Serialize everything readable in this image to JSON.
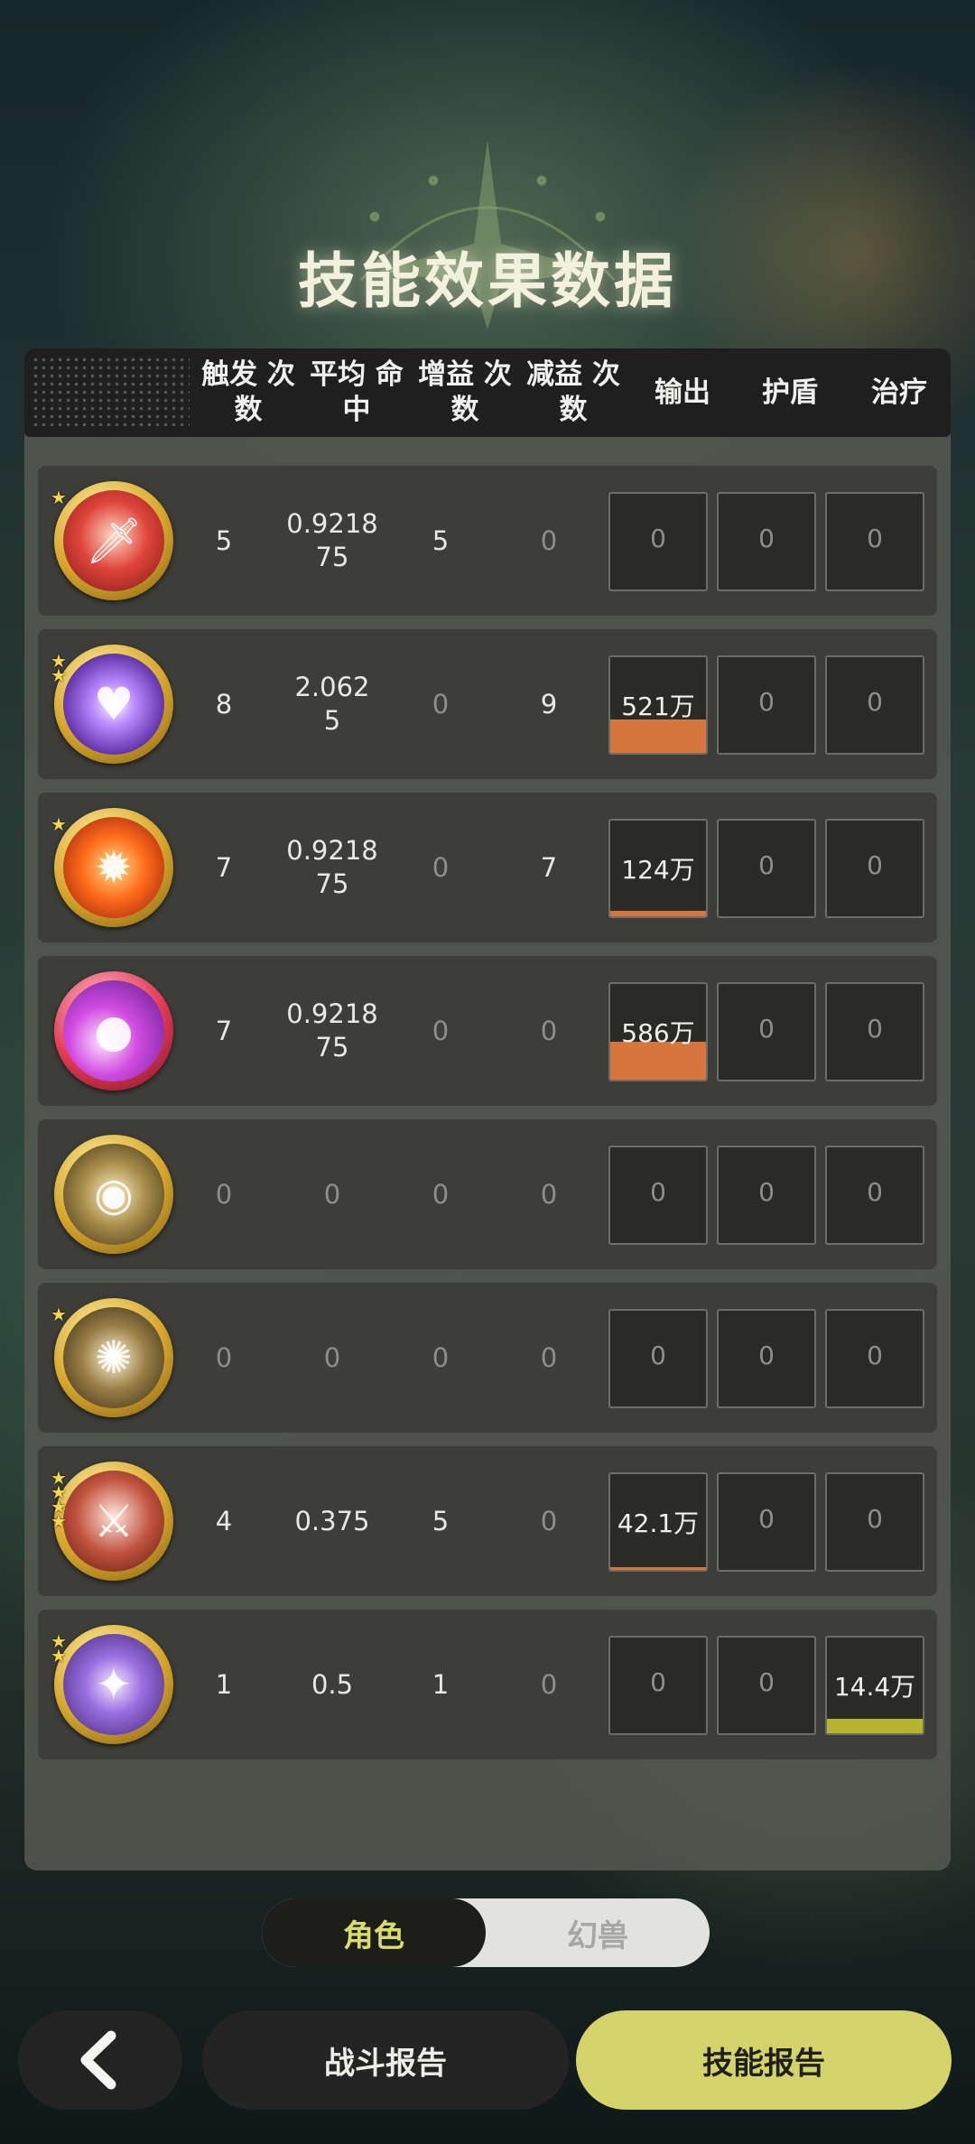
{
  "title": "技能效果数据",
  "columns": [
    "触发\n次数",
    "平均\n命中",
    "增益\n次数",
    "减益\n次数",
    "输出",
    "护盾",
    "治疗"
  ],
  "rows": [
    {
      "icon": "red-figure-sword-icon",
      "stars": 1,
      "trigger": "5",
      "avg_hit": "0.9218\n75",
      "buff": "5",
      "debuff": "0",
      "output": "0",
      "output_ratio": 0,
      "shield": "0",
      "heal": "0",
      "heal_ratio": 0
    },
    {
      "icon": "purple-heart-icon",
      "stars": 2,
      "trigger": "8",
      "avg_hit": "2.062\n5",
      "buff": "0",
      "debuff": "9",
      "output": "521万",
      "output_ratio": 0.35,
      "shield": "0",
      "heal": "0",
      "heal_ratio": 0
    },
    {
      "icon": "fire-emblem-icon",
      "stars": 1,
      "trigger": "7",
      "avg_hit": "0.9218\n75",
      "buff": "0",
      "debuff": "7",
      "output": "124万",
      "output_ratio": 0.06,
      "shield": "0",
      "heal": "0",
      "heal_ratio": 0
    },
    {
      "icon": "purple-orb-icon",
      "stars": 0,
      "trigger": "7",
      "avg_hit": "0.9218\n75",
      "buff": "0",
      "debuff": "0",
      "output": "586万",
      "output_ratio": 0.4,
      "shield": "0",
      "heal": "0",
      "heal_ratio": 0
    },
    {
      "icon": "eye-icon",
      "stars": 0,
      "trigger": "0",
      "avg_hit": "0",
      "buff": "0",
      "debuff": "0",
      "output": "0",
      "output_ratio": 0,
      "shield": "0",
      "heal": "0",
      "heal_ratio": 0
    },
    {
      "icon": "aperture-icon",
      "stars": 1,
      "trigger": "0",
      "avg_hit": "0",
      "buff": "0",
      "debuff": "0",
      "output": "0",
      "output_ratio": 0,
      "shield": "0",
      "heal": "0",
      "heal_ratio": 0
    },
    {
      "icon": "red-warrior-icon",
      "stars": 4,
      "trigger": "4",
      "avg_hit": "0.375",
      "buff": "5",
      "debuff": "0",
      "output": "42.1万",
      "output_ratio": 0.02,
      "shield": "0",
      "heal": "0",
      "heal_ratio": 0
    },
    {
      "icon": "purple-lightning-icon",
      "stars": 2,
      "trigger": "1",
      "avg_hit": "0.5",
      "buff": "1",
      "debuff": "0",
      "output": "0",
      "output_ratio": 0,
      "shield": "0",
      "heal": "14.4万",
      "heal_ratio": 0.15
    }
  ],
  "toggle": {
    "active": "角色",
    "inactive": "幻兽"
  },
  "buttons": {
    "back_icon": "chevron-left-icon",
    "battle_report": "战斗报告",
    "skill_report": "技能报告"
  },
  "colors": {
    "output_bar": "#d4763e",
    "heal_bar": "#b7b530",
    "accent": "#d3d36a"
  }
}
